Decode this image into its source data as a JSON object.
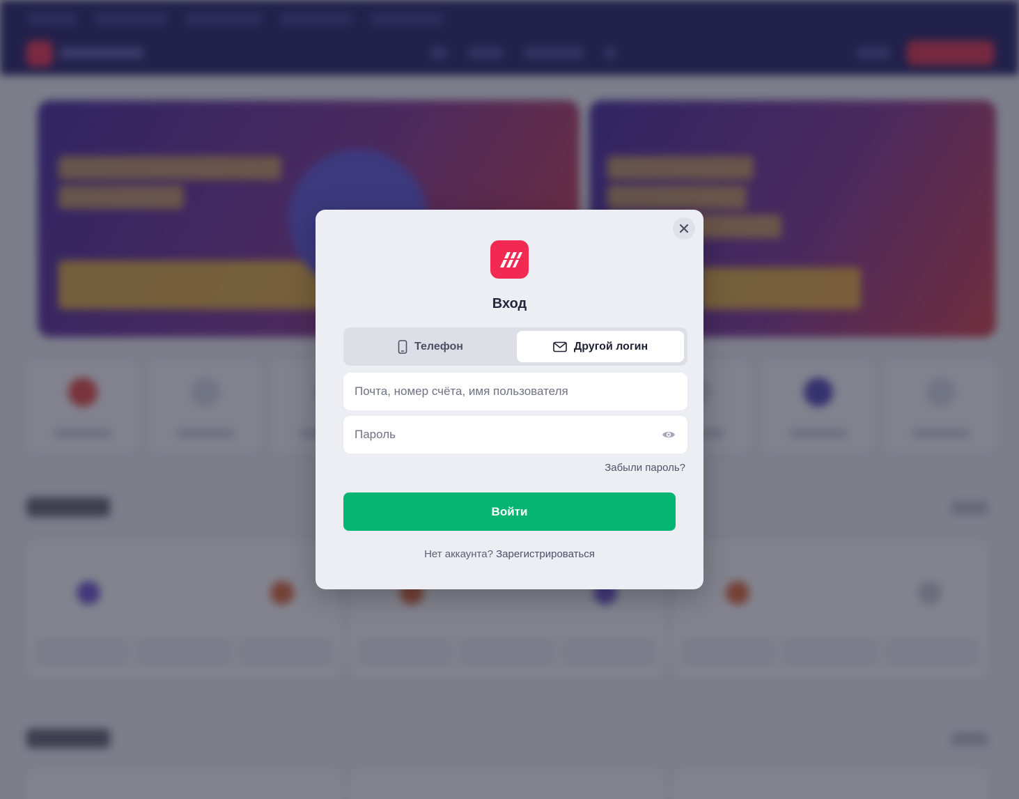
{
  "modal": {
    "title": "Вход",
    "tabs": [
      {
        "label": "Телефон",
        "icon": "phone-icon",
        "active": false
      },
      {
        "label": "Другой логин",
        "icon": "mail-icon",
        "active": true
      }
    ],
    "email_placeholder": "Почта, номер счёта, имя пользователя",
    "password_placeholder": "Пароль",
    "forgot_password": "Забыли пароль?",
    "submit_label": "Войти",
    "no_account_text": "Нет аккаунта?",
    "register_link": "Зарегистрироваться"
  },
  "colors": {
    "brand": "#f22a51",
    "submit": "#07b573",
    "header_bg": "#1a1660"
  }
}
